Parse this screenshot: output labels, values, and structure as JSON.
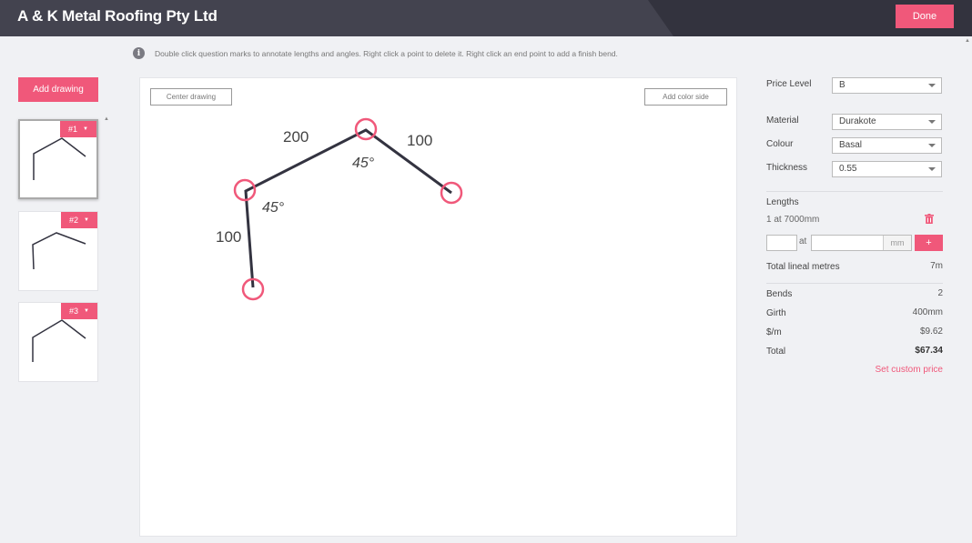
{
  "header": {
    "title": "A & K Metal Roofing Pty Ltd",
    "done_label": "Done"
  },
  "info": {
    "icon": "info-icon",
    "text": "Double click question marks to annotate lengths and angles. Right click a point to delete it. Right click an end point to add a finish bend."
  },
  "sidebar": {
    "add_label": "Add drawing",
    "thumbnails": [
      {
        "tag": "#1",
        "active": true
      },
      {
        "tag": "#2",
        "active": false
      },
      {
        "tag": "#3",
        "active": false
      }
    ]
  },
  "canvas": {
    "center_label": "Center drawing",
    "color_side_label": "Add color side",
    "lengths": [
      "200",
      "100",
      "100"
    ],
    "angles": [
      "45°",
      "45°"
    ]
  },
  "panel": {
    "price_level": {
      "label": "Price Level",
      "value": "B"
    },
    "material": {
      "label": "Material",
      "value": "Durakote"
    },
    "colour": {
      "label": "Colour",
      "value": "Basal"
    },
    "thickness": {
      "label": "Thickness",
      "value": "0.55"
    },
    "lengths": {
      "label": "Lengths",
      "entry": "1 at 7000mm",
      "at_label": "at",
      "unit": "mm",
      "add_label": "+"
    },
    "total_lineal": {
      "label": "Total lineal metres",
      "value": "7m"
    },
    "bends": {
      "label": "Bends",
      "value": "2"
    },
    "girth": {
      "label": "Girth",
      "value": "400mm"
    },
    "per_metre": {
      "label": "$/m",
      "value": "$9.62"
    },
    "total": {
      "label": "Total",
      "value": "$67.34"
    },
    "custom_price": "Set custom price"
  },
  "colors": {
    "accent": "#f0587a",
    "header": "#33333e",
    "line": "#333340"
  }
}
